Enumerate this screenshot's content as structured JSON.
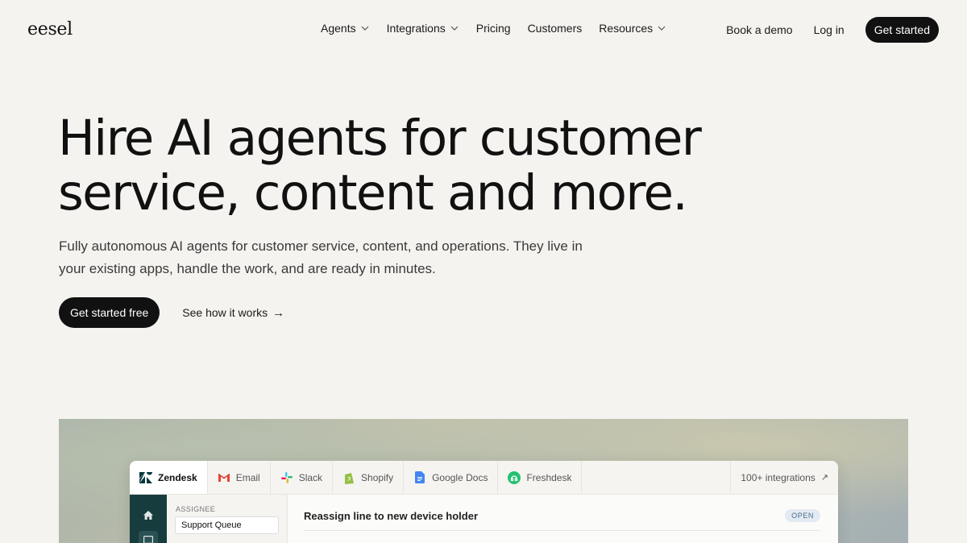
{
  "brand": {
    "logo_text": "eesel"
  },
  "nav": {
    "links": [
      {
        "label": "Agents",
        "has_dropdown": true
      },
      {
        "label": "Integrations",
        "has_dropdown": true
      },
      {
        "label": "Pricing",
        "has_dropdown": false
      },
      {
        "label": "Customers",
        "has_dropdown": false
      },
      {
        "label": "Resources",
        "has_dropdown": true
      }
    ],
    "book_demo": "Book a demo",
    "login": "Log in",
    "get_started": "Get started"
  },
  "hero": {
    "title_line1": "Hire AI agents for customer",
    "title_line2": "service, content and more.",
    "subtitle_line1": "Fully autonomous AI agents for customer service, content, and operations. They live in",
    "subtitle_line2": "your existing apps, handle the work, and are ready in minutes.",
    "primary_cta": "Get started free",
    "secondary_cta": "See how it works",
    "secondary_arrow": "→"
  },
  "app_preview": {
    "tabs": [
      {
        "label": "Zendesk",
        "icon": "zendesk-icon",
        "active": true
      },
      {
        "label": "Email",
        "icon": "gmail-icon",
        "active": false
      },
      {
        "label": "Slack",
        "icon": "slack-icon",
        "active": false
      },
      {
        "label": "Shopify",
        "icon": "shopify-icon",
        "active": false
      },
      {
        "label": "Google Docs",
        "icon": "google-docs-icon",
        "active": false
      },
      {
        "label": "Freshdesk",
        "icon": "freshdesk-icon",
        "active": false
      }
    ],
    "integrations_label": "100+ integrations",
    "integrations_arrow": "↗",
    "assignee_label": "ASSIGNEE",
    "assignee_value": "Support Queue",
    "ticket_title": "Reassign line to new device holder",
    "ticket_status": "OPEN"
  },
  "colors": {
    "background": "#f4f3ef",
    "primary_button": "#111111",
    "rail": "#173c3e",
    "zendesk": "#03363d",
    "freshdesk": "#25c16f",
    "shopify": "#95bf47",
    "google_docs": "#4285f4"
  }
}
